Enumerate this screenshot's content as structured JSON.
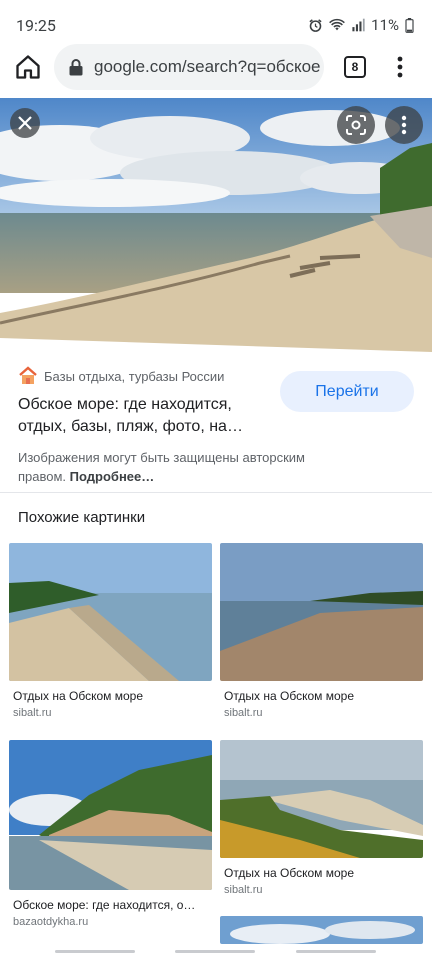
{
  "status_bar": {
    "time": "19:25",
    "battery": "11%"
  },
  "browser": {
    "url": "google.com/search?q=обское",
    "tab_count": "8"
  },
  "result": {
    "source_name": "Базы отдыха, турбазы России",
    "goto_label": "Перейти",
    "title_line1": "Обское море: где находится,",
    "title_line2": "отдых, базы, пляж, фото, на…",
    "copyright_text": "Изображения могут быть защищены авторским правом.",
    "more_link": "Подробнее…"
  },
  "similar": {
    "heading": "Похожие картинки",
    "items": [
      {
        "title": "Отдых на Обском море",
        "site": "sibalt.ru"
      },
      {
        "title": "Отдых на Обском море",
        "site": "sibalt.ru"
      },
      {
        "title": "Обское море: где находится, о…",
        "site": "bazaotdykha.ru"
      },
      {
        "title": "Отдых на Обском море",
        "site": "sibalt.ru"
      }
    ]
  },
  "icons": [
    "home-icon",
    "lock-icon",
    "more-vert-icon",
    "close-icon",
    "lens-icon",
    "alarm-icon",
    "wifi-icon",
    "signal-icon",
    "battery-icon"
  ],
  "colors": {
    "accent": "#1a73e8",
    "accent_bg": "#e8f0fe"
  }
}
